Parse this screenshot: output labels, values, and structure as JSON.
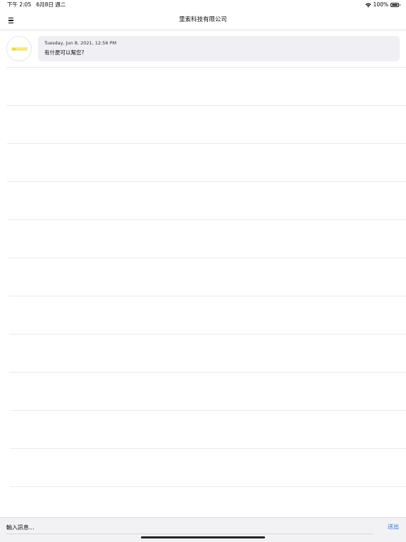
{
  "status_bar": {
    "time_date": "下午 2:05   6月8日 週二",
    "battery_percent": "100%",
    "battery_level": 1.0
  },
  "nav": {
    "title": "里索科技有限公司",
    "menu_icon": "hamburger-menu-icon"
  },
  "chat": {
    "messages": [
      {
        "timestamp": "Tuesday, Jun 8, 2021, 12:56 PM",
        "text": "有什麼可以幫您?"
      }
    ]
  },
  "composer": {
    "placeholder": "輸入訊息...",
    "value": "",
    "send_label": "送出"
  },
  "colors": {
    "bubble": "#efeff4",
    "send_accent": "#2a6fd6",
    "avatar_logo": "#f3e98a"
  }
}
